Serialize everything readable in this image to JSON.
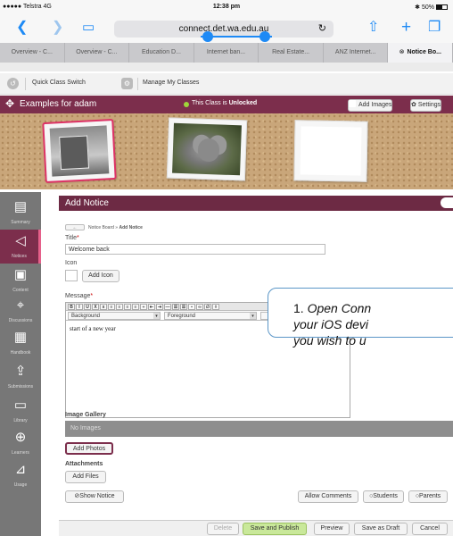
{
  "status_bar": {
    "carrier": "●●●●● Telstra  4G",
    "time": "12:38 pm",
    "battery": "50%"
  },
  "browser": {
    "url": "connect.det.wa.edu.au",
    "tabs": [
      {
        "label": "Overview - C...",
        "active": false
      },
      {
        "label": "Overview - C...",
        "active": false
      },
      {
        "label": "Education D...",
        "active": false
      },
      {
        "label": "Internet ban...",
        "active": false
      },
      {
        "label": "Real Estate...",
        "active": false
      },
      {
        "label": "ANZ Internet...",
        "active": false
      },
      {
        "label": "Notice Bo...",
        "active": true
      }
    ]
  },
  "toolbar": {
    "quick_switch": "Quick Class Switch",
    "manage": "Manage My Classes"
  },
  "class_bar": {
    "name": "Examples for adam",
    "unlock_text": "This Class is ",
    "unlock_bold": "Unlocked",
    "add_images": "Add Images",
    "settings": "Settings"
  },
  "sidebar": [
    {
      "label": "Summary",
      "icon": "summary-icon"
    },
    {
      "label": "Notices",
      "icon": "notices-icon",
      "active": true
    },
    {
      "label": "Content",
      "icon": "content-icon"
    },
    {
      "label": "Discussions",
      "icon": "discussions-icon"
    },
    {
      "label": "Handbook",
      "icon": "handbook-icon"
    },
    {
      "label": "Submissions",
      "icon": "submissions-icon"
    },
    {
      "label": "Library",
      "icon": "library-icon"
    },
    {
      "label": "Learners",
      "icon": "learners-icon"
    },
    {
      "label": "Usage",
      "icon": "usage-icon"
    }
  ],
  "panel": {
    "title": "Add Notice",
    "back_label": "←",
    "breadcrumb_prefix": "Notice Board » ",
    "breadcrumb_current": "Add Notice",
    "title_label": "Title",
    "title_value": "Welcome back",
    "icon_label": "Icon",
    "add_icon": "Add Icon",
    "message_label": "Message",
    "background_label": "Background",
    "foreground_label": "Foreground",
    "message_text": "start of a new year",
    "gallery_label": "Image Gallery",
    "no_images": "No Images",
    "add_photos": "Add Photos",
    "attachments_label": "Attachments",
    "add_files": "Add Files",
    "show_notice": "Show Notice",
    "allow_comments": "Allow Comments",
    "students": "Students",
    "parents": "Parents"
  },
  "actions": {
    "delete": "Delete",
    "save_publish": "Save and Publish",
    "preview": "Preview",
    "save_draft": "Save as Draft",
    "cancel": "Cancel"
  },
  "callout": {
    "number": "1. ",
    "text_line1": "Open Conn",
    "text_line2": "your iOS devi",
    "text_line3": "you wish to u"
  },
  "colors": {
    "brand": "#7c2e4c",
    "accent": "#1e8af5",
    "publish": "#c9e89a"
  }
}
